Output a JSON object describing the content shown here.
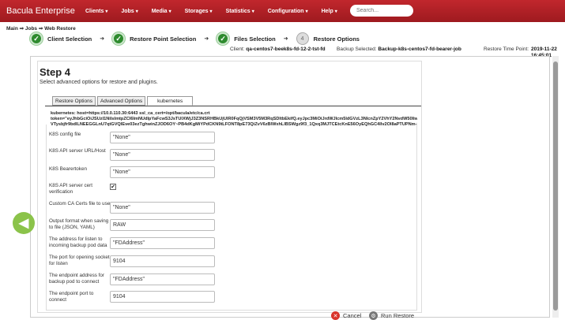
{
  "app": {
    "brand": "Bacula Enterprise"
  },
  "nav": {
    "items": [
      {
        "label": "Clients"
      },
      {
        "label": "Jobs"
      },
      {
        "label": "Media"
      },
      {
        "label": "Storages"
      },
      {
        "label": "Statistics"
      },
      {
        "label": "Configuration"
      },
      {
        "label": "Help"
      }
    ],
    "search_placeholder": "Search..."
  },
  "breadcrumb": "Main ⇒ Jobs ⇒ Web Restore",
  "wizard": {
    "steps": [
      {
        "label": "Client Selection",
        "state": "done"
      },
      {
        "label": "Restore Point Selection",
        "state": "done"
      },
      {
        "label": "Files Selection",
        "state": "done"
      },
      {
        "label": "Restore Options",
        "state": "current",
        "number": "4"
      }
    ]
  },
  "info": {
    "client_label": "Client:",
    "client_value": "qa-centos7-beek8s-fd-12-2-tst-fd",
    "backup_label": "Backup Selected:",
    "backup_value": "Backup-k8s-centos7-fd-bearer-job",
    "time_label": "Restore Time Point:",
    "time_value_date": "2019-11-22",
    "time_value_time": "16:45:01"
  },
  "step": {
    "title": "Step 4",
    "description": "Select advanced options for restore and plugins."
  },
  "tabs": [
    {
      "label": "Restore Options"
    },
    {
      "label": "Advanced Options"
    },
    {
      "label": "kubernetes"
    }
  ],
  "plugin": {
    "line1": "kubernetes: host=https://10.0.110.30:6443 ssl_ca_cert=/opt/bacula/etc/ca.crt",
    "line2": "token=\"eyJhbGciOiJSUzI1NiIsImtpZCI6ImNUdlpYaFcwS3JsTUlXWjJ3Z3NSRHBkUjUlR0FqQjVSM3V5M3RqSDltbEkifQ.eyJpc3MiOiJrdWJlcm5ldGVzL3NlcnZpY2VhY2NvdW50IiwiaW3ViZXJuZXRlcy5pby9zZXJ2aWNl",
    "line3": "VTysbjfr9bdlLNEEGGLnU7qtGVQIEve03ezTghwinZJOD6OY~PB4dKgMiYPdCKN9tLFONT8pE73QiZvV6zBlWxhLlBSWgz9f3_1Qxq3MJTCEtcKnE56OyEQhGC4llv2Ol8aPTUPNm-izP97dwasoozFxWnTPJFed0lBRFKc"
  },
  "form": {
    "rows": [
      {
        "label": "K8S config file",
        "value": "\"None\""
      },
      {
        "label": "K8S API server URL/Host",
        "value": "\"None\""
      },
      {
        "label": "K8S Bearertoken",
        "value": "\"None\""
      },
      {
        "label": "K8S API server cert verification",
        "checked": "✔"
      },
      {
        "label": "Custom CA Certs file to use",
        "value": "\"None\""
      },
      {
        "label": "Output format when saving to file (JSON, YAML)",
        "value": "RAW"
      },
      {
        "label": "The address for listen to incoming backup pod data",
        "value": "\"FDAddress\""
      },
      {
        "label": "The port for opening socket for listen",
        "value": "9104"
      },
      {
        "label": "The endpoint address for backup pod to connect",
        "value": "\"FDAddress\""
      },
      {
        "label": "The endpoint port to connect",
        "value": "9104"
      }
    ]
  },
  "buttons": {
    "cancel": "Cancel",
    "run": "Run Restore"
  },
  "colors": {
    "topbar": "#b22228",
    "done_step": "#2e8b2e",
    "back_button": "#8bc34a",
    "cancel_icon": "#d9342b"
  }
}
